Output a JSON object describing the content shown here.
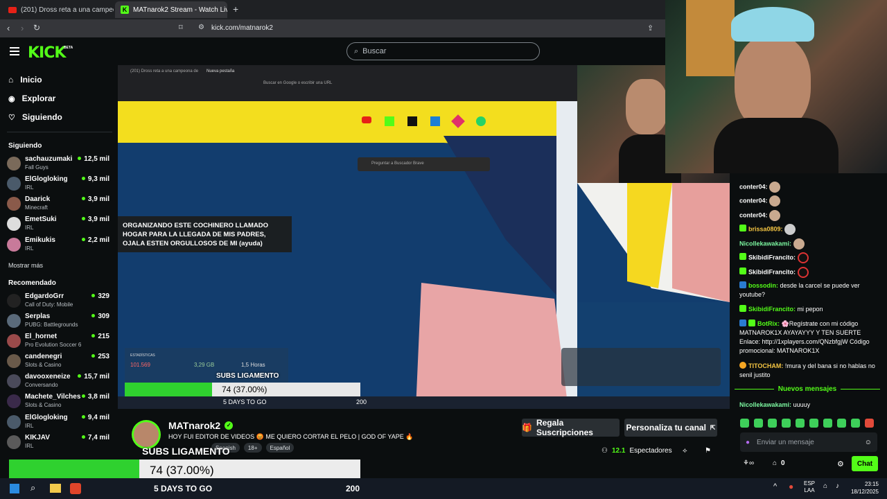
{
  "browser": {
    "tabs": [
      {
        "title": "(201) Dross reta a una campeona de"
      },
      {
        "title": "MATnarok2 Stream - Watch Live"
      }
    ],
    "url": "kick.com/matnarok2"
  },
  "header": {
    "logo": "KICK",
    "beta": "BETA",
    "search_placeholder": "Buscar"
  },
  "sidebar": {
    "nav": [
      {
        "label": "Inicio",
        "icon": "home-icon"
      },
      {
        "label": "Explorar",
        "icon": "compass-icon"
      },
      {
        "label": "Siguiendo",
        "icon": "heart-icon"
      }
    ],
    "following_title": "Siguiendo",
    "following": [
      {
        "name": "sachauzumaki",
        "category": "Fall Guys",
        "viewers": "12,5 mil"
      },
      {
        "name": "ElGlogloking",
        "category": "IRL",
        "viewers": "9,3 mil"
      },
      {
        "name": "Daarick",
        "category": "Minecraft",
        "viewers": "3,9 mil"
      },
      {
        "name": "EmetSuki",
        "category": "IRL",
        "viewers": "3,9 mil"
      },
      {
        "name": "Emikukis",
        "category": "IRL",
        "viewers": "2,2 mil"
      }
    ],
    "show_more": "Mostrar más",
    "recommended_title": "Recomendado",
    "recommended": [
      {
        "name": "EdgardoGrr",
        "category": "Call of Duty: Mobile",
        "viewers": "329"
      },
      {
        "name": "Serplas",
        "category": "PUBG: Battlegrounds",
        "viewers": "309"
      },
      {
        "name": "El_hornet",
        "category": "Pro Evolution Soccer 6",
        "viewers": "215"
      },
      {
        "name": "candenegri",
        "category": "Slots & Casino",
        "viewers": "253"
      },
      {
        "name": "davooxeneize",
        "category": "Conversando",
        "viewers": "15,7 mil"
      },
      {
        "name": "Machete_Vilches",
        "category": "Slots & Casino",
        "viewers": "3,8 mil"
      },
      {
        "name": "ElGlogloking",
        "category": "IRL",
        "viewers": "9,4 mil"
      },
      {
        "name": "KIKJAV",
        "category": "IRL",
        "viewers": "7,4 mil"
      }
    ]
  },
  "tooltip": "ORGANIZANDO ESTE COCHINERO LLAMADO HOGAR PARA LA LLEGADA DE MIS PADRES, OJALA ESTEN ORGULLOSOS DE MI (ayuda)",
  "video_overlay": {
    "inner_tabs": [
      "(201) Dross reta a una campeona de",
      "Nueva pestaña"
    ],
    "inner_url": "Buscar en Google o escribir una URL",
    "inner_search": "Preguntar a Buscador Brave",
    "stats_title": "ESTADÍSTICAS",
    "stats": [
      "101.569",
      "3,29 GB",
      "1,5 Horas"
    ],
    "goal_title": "SUBS LIGAMENTO",
    "goal_progress": "74 (37.00%)",
    "goal_fraction": 0.37,
    "goal_days": "5 DAYS TO GO",
    "goal_target": "200"
  },
  "channel": {
    "name": "MATnarok2",
    "title": "HOY FUI EDITOR DE VIDEOS 😡 ME QUIERO CORTAR EL PELO | GOD OF YAPE 🔥",
    "tags": [
      "Spanish",
      "18+",
      "Español"
    ],
    "gift_button": "Regala Suscripciones",
    "customize_button": "Personaliza tu canal",
    "viewers": "12.1",
    "viewers_label": "Espectadores"
  },
  "chat": {
    "messages": [
      {
        "user": "conter04:",
        "text": "",
        "color": "#ffffff",
        "emote": true
      },
      {
        "user": "conter04:",
        "text": "",
        "color": "#ffffff",
        "emote": true
      },
      {
        "user": "conter04:",
        "text": "",
        "color": "#ffffff",
        "emote": true
      },
      {
        "user": "brissa0809:",
        "text": "",
        "color": "#53fc18",
        "emote": true
      },
      {
        "user": "Nicollekawakami:",
        "text": "",
        "color": "#53fc18",
        "emote": true
      },
      {
        "user": "SkibidiFrancito:",
        "text": "",
        "color": "#ffffff",
        "emote": true
      },
      {
        "user": "SkibidiFrancito:",
        "text": "",
        "color": "#ffffff",
        "emote": true
      },
      {
        "user": "bossodin:",
        "text": "desde la carcel se puede ver youtube?",
        "color": "#53fc18"
      },
      {
        "user": "SkibidiFrancito:",
        "text": "mi pepon",
        "color": "#53fc18"
      },
      {
        "user": "BotRix:",
        "text": "🌸Regístrate con mi código MATNAROK1X AYAYAYYY Y TEN SUERTE Enlace: http://1xplayers.com/QNzbfgjW Código promocional: MATNAROK1X",
        "color": "#53fc18"
      },
      {
        "user": "TITOCHAM:",
        "text": "!mura y del bana si no hablas no senil justito",
        "color": "#f5c542"
      }
    ],
    "new_messages": "Nuevos mensajes",
    "last": {
      "user": "Nicollekawakami:",
      "text": "uuuuy"
    },
    "input_placeholder": "Enviar un mensaje",
    "points": "0",
    "send_button": "Chat"
  },
  "bottom_goal": {
    "title": "SUBS LIGAMENTO",
    "progress": "74 (37.00%)",
    "fraction": 0.37,
    "days": "5 DAYS TO GO",
    "target": "200"
  },
  "taskbar": {
    "lang": "ESP",
    "lang2": "LAA",
    "time": "23:15",
    "date": "18/12/2025"
  },
  "colors": {
    "accent": "#53fc18",
    "background": "#0b0e0f"
  }
}
